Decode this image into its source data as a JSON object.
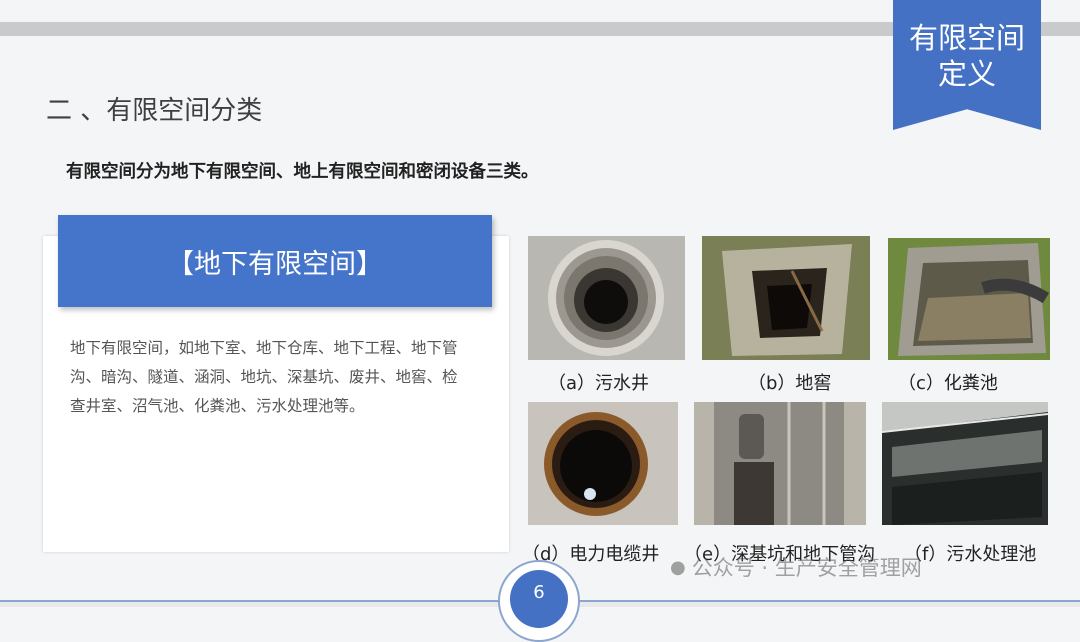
{
  "banner": {
    "line1": "有限空间",
    "line2": "定义"
  },
  "section_title": "二 、有限空间分类",
  "intro": "有限空间分为地下有限空间、地上有限空间和密闭设备三类。",
  "card": {
    "header": "【地下有限空间】",
    "body": "地下有限空间，如地下室、地下仓库、地下工程、地下管沟、暗沟、隧道、涵洞、地坑、深基坑、废井、地窖、检查井室、沼气池、化粪池、污水处理池等。"
  },
  "photos": [
    {
      "caption": "（a）污水井",
      "icon": "manhole-photo"
    },
    {
      "caption": "（b）地窖",
      "icon": "cellar-photo"
    },
    {
      "caption": "（c）化粪池",
      "icon": "septic-tank-photo"
    },
    {
      "caption": "（d）电力电缆井",
      "icon": "cable-well-photo"
    },
    {
      "caption": "（e）深基坑和地下管沟",
      "icon": "deep-pit-photo"
    },
    {
      "caption": "（f）污水处理池",
      "icon": "treatment-pool-photo"
    }
  ],
  "page_number": "6",
  "watermark": "公众号 · 生产安全管理网"
}
